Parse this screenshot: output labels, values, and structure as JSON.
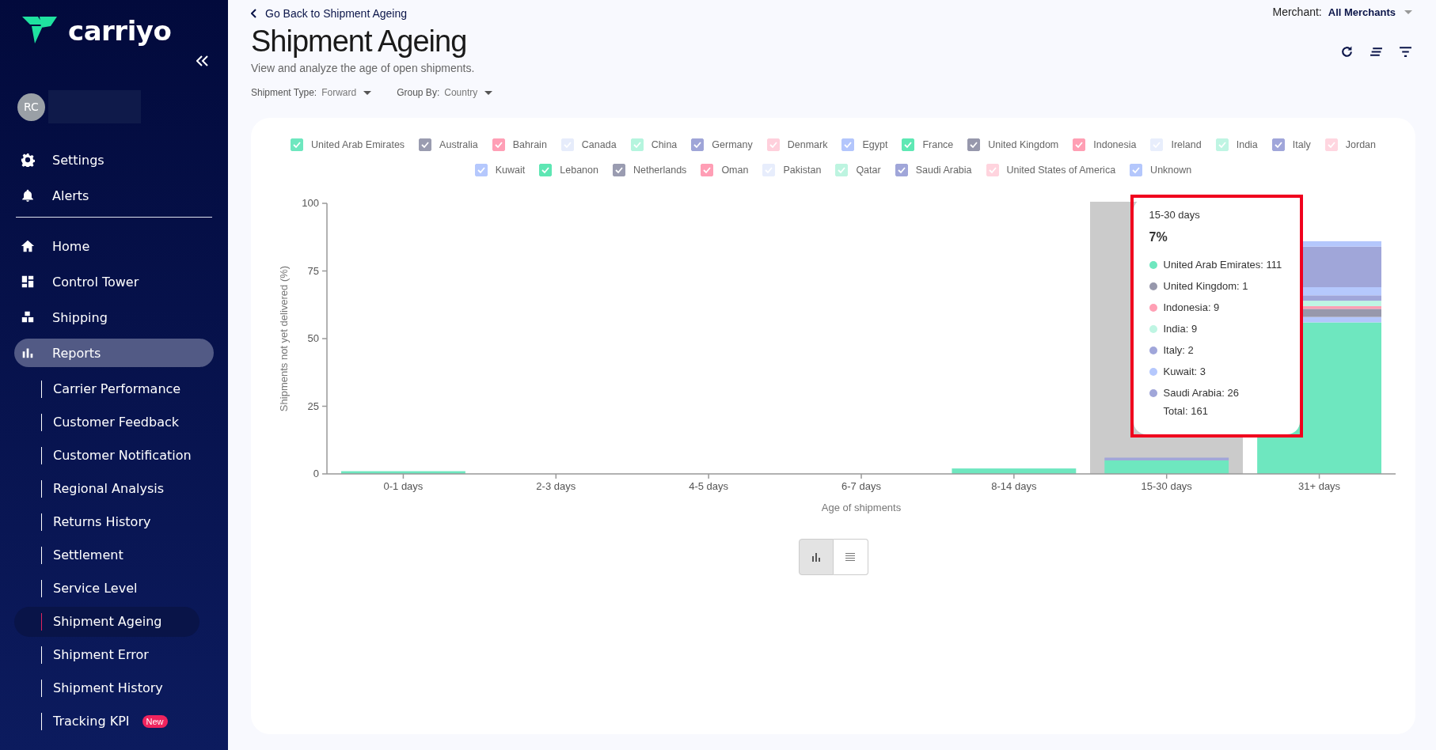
{
  "sidebar": {
    "logo": "carriyo",
    "user_initials": "RC",
    "top_items": [
      {
        "label": "Settings",
        "selected": false
      },
      {
        "label": "Alerts",
        "selected": false
      }
    ],
    "nav_items": [
      {
        "label": "Home",
        "selected": false
      },
      {
        "label": "Control Tower",
        "selected": false
      },
      {
        "label": "Shipping",
        "selected": false
      },
      {
        "label": "Reports",
        "selected": true
      }
    ],
    "sub_items": [
      {
        "label": "Carrier Performance",
        "selected": false
      },
      {
        "label": "Customer Feedback",
        "selected": false
      },
      {
        "label": "Customer Notification",
        "selected": false
      },
      {
        "label": "Regional Analysis",
        "selected": false
      },
      {
        "label": "Returns History",
        "selected": false
      },
      {
        "label": "Settlement",
        "selected": false
      },
      {
        "label": "Service Level",
        "selected": false
      },
      {
        "label": "Shipment Ageing",
        "selected": true
      },
      {
        "label": "Shipment Error",
        "selected": false
      },
      {
        "label": "Shipment History",
        "selected": false
      },
      {
        "label": "Tracking KPI",
        "selected": false,
        "badge": "New"
      }
    ]
  },
  "header": {
    "back_link": "Go Back to Shipment Ageing",
    "title": "Shipment Ageing",
    "subtitle": "View and analyze the age of open shipments.",
    "merchant_label": "Merchant:",
    "merchant_value": "All Merchants",
    "filters": [
      {
        "label": "Shipment Type:",
        "value": "Forward"
      },
      {
        "label": "Group By:",
        "value": "Country"
      }
    ]
  },
  "chart": {
    "legend_checked": [
      true,
      true,
      true,
      true,
      true,
      true,
      true,
      true,
      true,
      true,
      true,
      true,
      true,
      true,
      true,
      true,
      true,
      true,
      true,
      true,
      true,
      true,
      true,
      true
    ],
    "chart_data": {
      "type": "bar",
      "stacked": true,
      "xlabel": "Age of shipments",
      "ylabel": "Shipments not yet delivered (%)",
      "categories": [
        "0-1 days",
        "2-3 days",
        "4-5 days",
        "6-7 days",
        "8-14 days",
        "15-30 days",
        "31+ days"
      ],
      "ylim": [
        0,
        100
      ],
      "yticks": [
        0,
        25,
        50,
        75,
        100
      ],
      "series": [
        {
          "name": "United Arab Emirates",
          "color": "#6ee7bf",
          "values": [
            1,
            0,
            0,
            0,
            2,
            5,
            56
          ]
        },
        {
          "name": "Australia",
          "color": "#9a9cb0",
          "values": [
            0,
            0,
            0,
            0,
            0,
            0,
            0
          ]
        },
        {
          "name": "Bahrain",
          "color": "#ff9fb6",
          "values": [
            0,
            0,
            0,
            0,
            0,
            0,
            0
          ]
        },
        {
          "name": "Canada",
          "color": "#e6ecfb",
          "values": [
            0,
            0,
            0,
            0,
            0,
            0,
            0
          ]
        },
        {
          "name": "China",
          "color": "#b5f5de",
          "values": [
            0,
            0,
            0,
            0,
            0,
            0,
            0
          ]
        },
        {
          "name": "Germany",
          "color": "#9fa5d8",
          "values": [
            0,
            0,
            0,
            0,
            0,
            0,
            0
          ]
        },
        {
          "name": "Denmark",
          "color": "#ffd0dc",
          "values": [
            0,
            0,
            0,
            0,
            0,
            0,
            0
          ]
        },
        {
          "name": "Egypt",
          "color": "#b3c6fc",
          "values": [
            0,
            0,
            0,
            0,
            0,
            0,
            2
          ]
        },
        {
          "name": "France",
          "color": "#5ee8b4",
          "values": [
            0,
            0,
            0,
            0,
            0,
            0,
            0
          ]
        },
        {
          "name": "United Kingdom",
          "color": "#9798ac",
          "values": [
            0,
            0,
            0,
            0,
            0,
            null,
            3
          ]
        },
        {
          "name": "Indonesia",
          "color": "#ff9fb4",
          "values": [
            0,
            0,
            0,
            0,
            0,
            null,
            1
          ]
        },
        {
          "name": "Ireland",
          "color": "#e8eefc",
          "values": [
            0,
            0,
            0,
            0,
            0,
            0,
            0
          ]
        },
        {
          "name": "India",
          "color": "#bff5e3",
          "values": [
            0,
            0,
            0,
            0,
            0,
            null,
            2
          ]
        },
        {
          "name": "Italy",
          "color": "#a0a6da",
          "values": [
            0,
            0,
            0,
            0,
            0,
            null,
            2
          ]
        },
        {
          "name": "Jordan",
          "color": "#ffd6e0",
          "values": [
            0,
            0,
            0,
            0,
            0,
            0,
            0
          ]
        },
        {
          "name": "Kuwait",
          "color": "#b5c8fd",
          "values": [
            0,
            0,
            0,
            0,
            0,
            null,
            3
          ]
        },
        {
          "name": "Lebanon",
          "color": "#5ee6b3",
          "values": [
            0,
            0,
            0,
            0,
            0,
            0,
            0
          ]
        },
        {
          "name": "Netherlands",
          "color": "#9a9cb1",
          "values": [
            0,
            0,
            0,
            0,
            0,
            0,
            0
          ]
        },
        {
          "name": "Oman",
          "color": "#ff9eb5",
          "values": [
            0,
            0,
            0,
            0,
            0,
            0,
            0
          ]
        },
        {
          "name": "Pakistan",
          "color": "#e7edfc",
          "values": [
            0,
            0,
            0,
            0,
            0,
            0,
            0
          ]
        },
        {
          "name": "Qatar",
          "color": "#bdf4e0",
          "values": [
            0,
            0,
            0,
            0,
            0,
            0,
            0
          ]
        },
        {
          "name": "Saudi Arabia",
          "color": "#a0a6d9",
          "values": [
            0,
            0,
            0,
            0,
            0,
            1,
            15
          ]
        },
        {
          "name": "United States of America",
          "color": "#ffd4de",
          "values": [
            0,
            0,
            0,
            0,
            0,
            0,
            0
          ]
        },
        {
          "name": "Unknown",
          "color": "#b4c7fc",
          "values": [
            0,
            0,
            0,
            0,
            0,
            0,
            2
          ]
        }
      ]
    }
  },
  "tooltip": {
    "title": "15-30 days",
    "percent": "7%",
    "items": [
      {
        "text": "United Arab Emirates: 111",
        "color": "#6ee7bf"
      },
      {
        "text": "United Kingdom: 1",
        "color": "#9798ac"
      },
      {
        "text": "Indonesia: 9",
        "color": "#ff9fb4"
      },
      {
        "text": "India: 9",
        "color": "#bff5e3"
      },
      {
        "text": "Italy: 2",
        "color": "#a0a6da"
      },
      {
        "text": "Kuwait: 3",
        "color": "#b5c8fd"
      },
      {
        "text": "Saudi Arabia: 26",
        "color": "#a0a6d9"
      }
    ],
    "total": "Total: 161"
  },
  "view_toggle": [
    {
      "kind": "chart",
      "selected": true
    },
    {
      "kind": "table",
      "selected": false
    }
  ]
}
